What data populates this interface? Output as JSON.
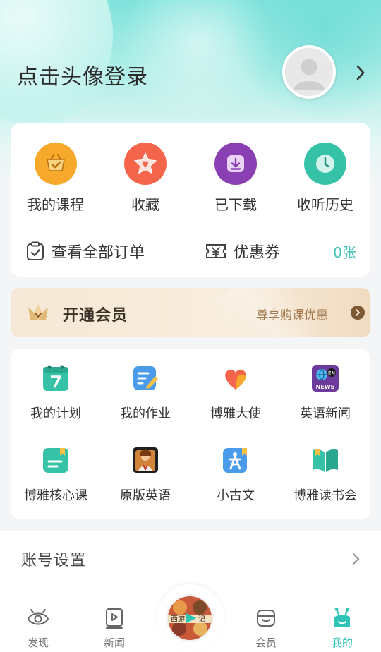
{
  "header": {
    "login_prompt": "点击头像登录"
  },
  "quick_actions": [
    {
      "label": "我的课程",
      "icon": "course-basket-icon",
      "color": "#f7a92c"
    },
    {
      "label": "收藏",
      "icon": "favorite-star-icon",
      "color": "#f4654c"
    },
    {
      "label": "已下载",
      "icon": "download-icon",
      "color": "#8a3fb3"
    },
    {
      "label": "收听历史",
      "icon": "history-clock-icon",
      "color": "#36c2a6"
    }
  ],
  "orders": {
    "label": "查看全部订单"
  },
  "coupons": {
    "label": "优惠券",
    "count": "0张"
  },
  "vip": {
    "title": "开通会员",
    "promo": "尊享购课优惠"
  },
  "features": [
    {
      "label": "我的计划",
      "icon": "calendar-icon"
    },
    {
      "label": "我的作业",
      "icon": "homework-icon"
    },
    {
      "label": "博雅大使",
      "icon": "ambassador-heart-icon"
    },
    {
      "label": "英语新闻",
      "icon": "english-news-icon",
      "badge_text": "NEWS",
      "badge_small": "EN"
    },
    {
      "label": "博雅核心课",
      "icon": "core-course-icon"
    },
    {
      "label": "原版英语",
      "icon": "original-english-icon"
    },
    {
      "label": "小古文",
      "icon": "classical-chinese-icon"
    },
    {
      "label": "博雅读书会",
      "icon": "reading-club-icon"
    }
  ],
  "settings": {
    "account": "账号设置"
  },
  "tabbar": {
    "items": [
      {
        "label": "发现",
        "icon": "discover-eye-icon"
      },
      {
        "label": "新闻",
        "icon": "news-play-icon"
      },
      {
        "label": "会员",
        "icon": "member-box-icon"
      },
      {
        "label": "我的",
        "icon": "me-robot-icon"
      }
    ],
    "active_index": 3,
    "active_color": "#2ec4b6",
    "center_disc_text": [
      "西游",
      "记"
    ]
  }
}
